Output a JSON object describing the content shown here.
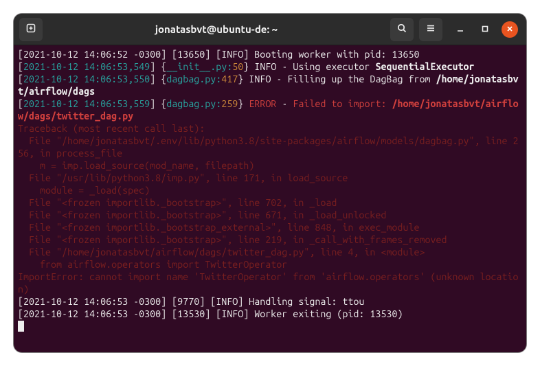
{
  "titlebar": {
    "title": "jonatasbvt@ubuntu-de: ~"
  },
  "log": {
    "l1_a": "[2021-10-12 14:06:52 -0300] [13650] [INFO] Booting worker with pid: 13650",
    "l2_a": "[",
    "l2_b": "2021-10-12 14:06:53,549",
    "l2_c": "] {",
    "l2_d": "__init__.py:",
    "l2_e": "50",
    "l2_f": "} INFO - Using executor ",
    "l2_g": "SequentialExecutor",
    "l3_a": "[",
    "l3_b": "2021-10-12 14:06:53,550",
    "l3_c": "] {",
    "l3_d": "dagbag.py:",
    "l3_e": "417",
    "l3_f": "} INFO - Filling up the DagBag from ",
    "l3_g": "/home/jonatasbvt/airflow/dags",
    "l4_a": "[",
    "l4_b": "2021-10-12 14:06:53,559",
    "l4_c": "] {",
    "l4_d": "dagbag.py:",
    "l4_e": "259",
    "l4_f": "} ",
    "l4_g": "ERROR",
    "l4_h": " - ",
    "l4_i": "Failed to import: ",
    "l4_j": "/home/jonatasbvt/airflow/dags/twitter_dag.py",
    "tb0": "Traceback (most recent call last):",
    "tb1": "  File \"/home/jonatasbvt/.env/lib/python3.8/site-packages/airflow/models/dagbag.py\", line 256, in process_file",
    "tb2": "    m = imp.load_source(mod_name, filepath)",
    "tb3": "  File \"/usr/lib/python3.8/imp.py\", line 171, in load_source",
    "tb4": "    module = _load(spec)",
    "tb5": "  File \"<frozen importlib._bootstrap>\", line 702, in _load",
    "tb6": "  File \"<frozen importlib._bootstrap>\", line 671, in _load_unlocked",
    "tb7": "  File \"<frozen importlib._bootstrap_external>\", line 848, in exec_module",
    "tb8": "  File \"<frozen importlib._bootstrap>\", line 219, in _call_with_frames_removed",
    "tb9": "  File \"/home/jonatasbvt/airflow/dags/twitter_dag.py\", line 4, in <module>",
    "tb10": "    from airflow.operators import TwitterOperator",
    "tb11": "ImportError: cannot import name 'TwitterOperator' from 'airflow.operators' (unknown location)",
    "l5": "[2021-10-12 14:06:53 -0300] [9770] [INFO] Handling signal: ttou",
    "l6": "[2021-10-12 14:06:53 -0300] [13530] [INFO] Worker exiting (pid: 13530)"
  }
}
